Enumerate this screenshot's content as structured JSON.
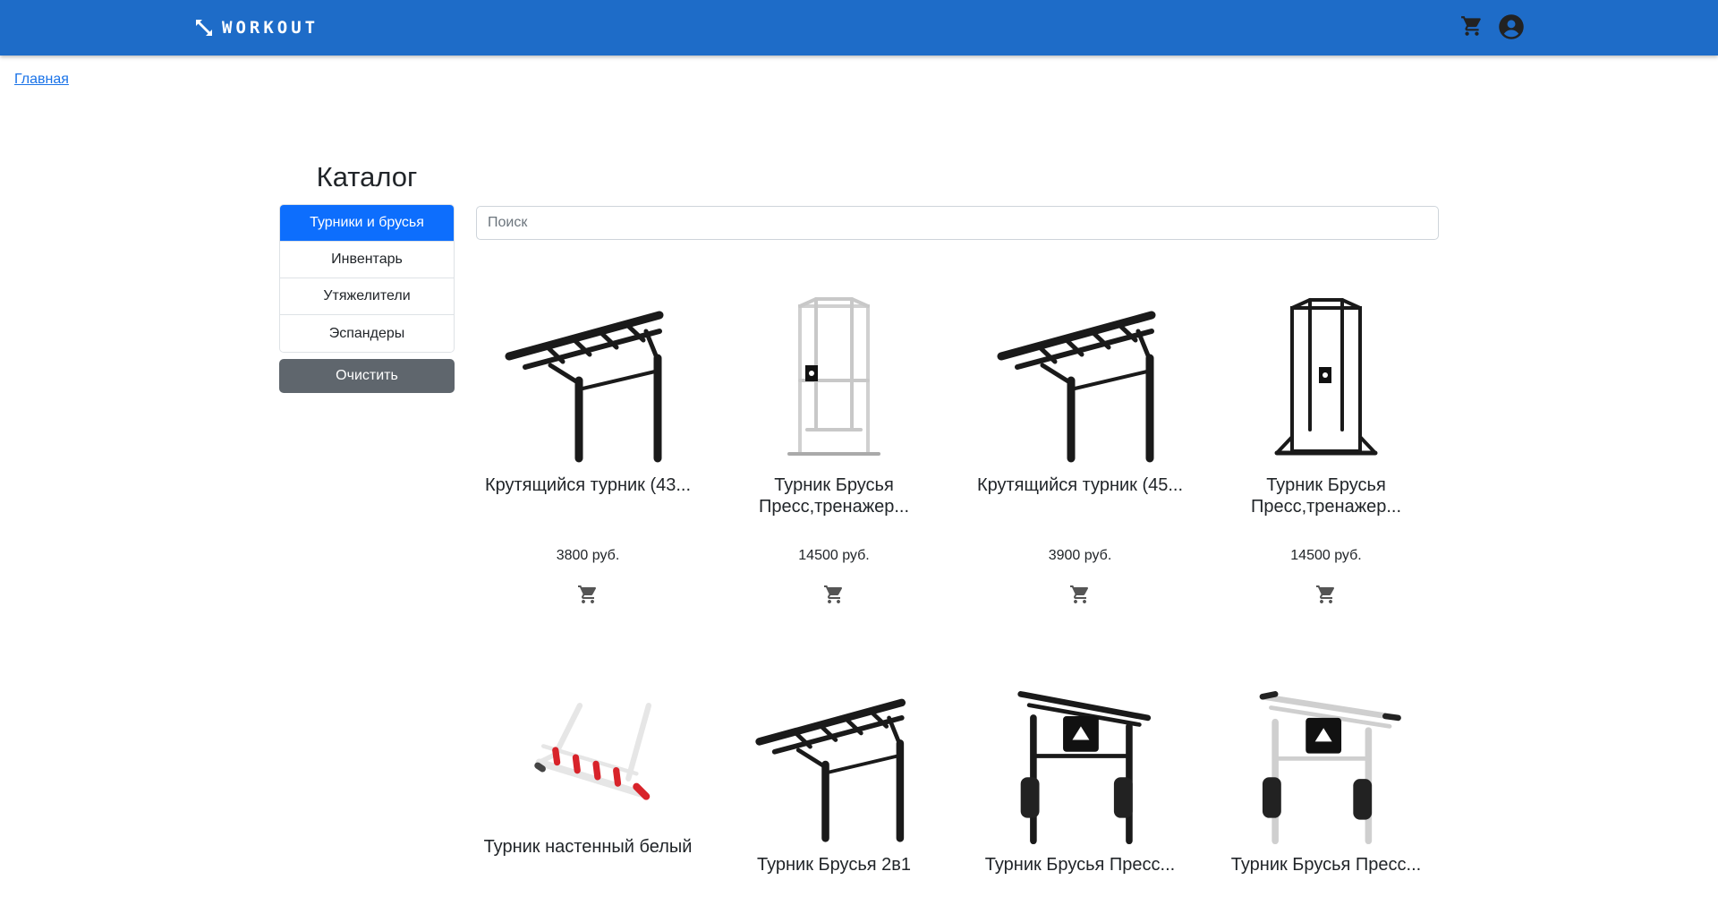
{
  "brand": {
    "name": "WORKOUT"
  },
  "header": {
    "cart_icon": "cart-icon",
    "account_icon": "account-circle-icon"
  },
  "breadcrumb": {
    "home": "Главная"
  },
  "catalog": {
    "title": "Каталог",
    "categories": [
      {
        "label": "Турники и брусья",
        "active": true
      },
      {
        "label": "Инвентарь",
        "active": false
      },
      {
        "label": "Утяжелители",
        "active": false
      },
      {
        "label": "Эспандеры",
        "active": false
      }
    ],
    "clear_label": "Очистить"
  },
  "search": {
    "placeholder": "Поиск",
    "value": ""
  },
  "products": [
    {
      "name": "Крутящийся турник (43...",
      "price": "3800 руб.",
      "image": "wall-pullup-bar-black"
    },
    {
      "name": "Турник Брусья Пресс,тренажер...",
      "price": "14500 руб.",
      "image": "power-tower-white"
    },
    {
      "name": "Крутящийся турник (45...",
      "price": "3900 руб.",
      "image": "wall-pullup-bar-black"
    },
    {
      "name": "Турник Брусья Пресс,тренажер...",
      "price": "14500 руб.",
      "image": "power-tower-black"
    },
    {
      "name": "Турник настенный белый",
      "price": "",
      "image": "wall-bar-white-red"
    },
    {
      "name": "Турник Брусья 2в1",
      "price": "",
      "image": "wall-pullup-bar-black"
    },
    {
      "name": "Турник Брусья Пресс...",
      "price": "",
      "image": "wall-station-black"
    },
    {
      "name": "Турник Брусья Пресс...",
      "price": "",
      "image": "wall-station-white"
    }
  ],
  "colors": {
    "header": "#1e6cc8",
    "active_category": "#0d6efd",
    "clear_button": "#5f666d",
    "link": "#1a73e8"
  }
}
